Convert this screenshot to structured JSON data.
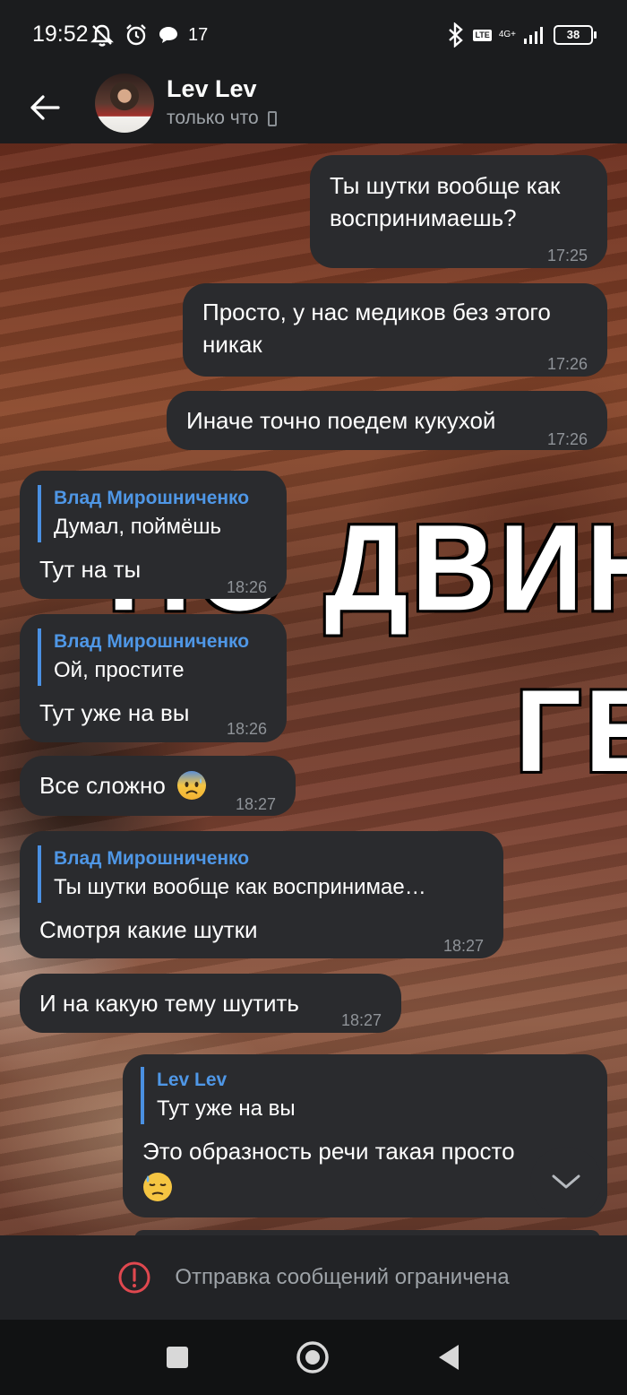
{
  "status_bar": {
    "time": "19:52",
    "notification_count": "17",
    "battery": "38",
    "network_label": "4G+",
    "lte_label": "LTE"
  },
  "header": {
    "contact_name": "Lev Lev",
    "last_seen": "только что"
  },
  "wallpaper": {
    "line1": "ПО ДВИН",
    "line2": "ГЕ"
  },
  "messages": [
    {
      "side": "out",
      "text_lines": [
        "Ты шутки вообще как",
        "воспринимаешь?"
      ],
      "time": "17:25"
    },
    {
      "side": "out",
      "text_lines": [
        "Просто, у нас медиков без этого",
        "никак"
      ],
      "time": "17:26"
    },
    {
      "side": "out",
      "text_lines": [
        "Иначе точно поедем кукухой"
      ],
      "time": "17:26"
    },
    {
      "side": "in",
      "reply_author": "Влад Мирошниченко",
      "reply_text": "Думал, поймёшь",
      "text_lines": [
        "Тут на ты"
      ],
      "time": "18:26"
    },
    {
      "side": "in",
      "reply_author": "Влад Мирошниченко",
      "reply_text": "Ой, простите",
      "text_lines": [
        "Тут уже на вы"
      ],
      "time": "18:26"
    },
    {
      "side": "in",
      "text_lines": [
        "Все сложно"
      ],
      "emoji": "anxious-face",
      "time": "18:27"
    },
    {
      "side": "in",
      "reply_author": "Влад Мирошниченко",
      "reply_text": "Ты шутки вообще как воспринимае…",
      "text_lines": [
        "Смотря какие шутки"
      ],
      "time": "18:27"
    },
    {
      "side": "in",
      "text_lines": [
        "И на какую тему шутить"
      ],
      "time": "18:27"
    },
    {
      "side": "out",
      "reply_author": "Lev Lev",
      "reply_text": "Тут уже на вы",
      "text_lines": [
        "Это образность речи такая просто"
      ],
      "emoji": "downcast-sweat-face"
    }
  ],
  "bottom": {
    "restriction_text": "Отправка сообщений ограничена"
  },
  "colors": {
    "bubble": "#2a2b2e",
    "reply_accent": "#4a90e2",
    "warning": "#e0484f"
  }
}
